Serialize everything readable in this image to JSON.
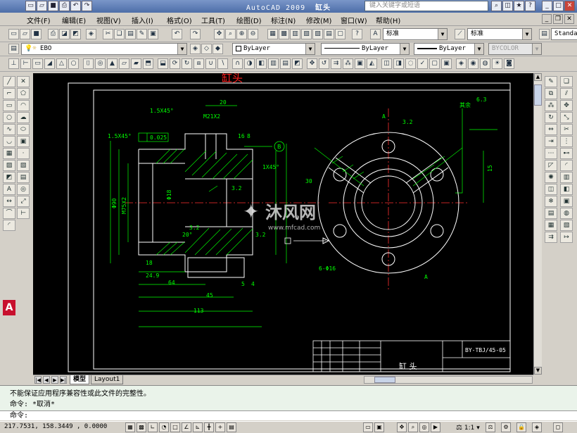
{
  "app": {
    "title": "AutoCAD 2009",
    "document": "缸头",
    "search_placeholder": "键入关键字或短语"
  },
  "menu": [
    "文件(F)",
    "编辑(E)",
    "视图(V)",
    "插入(I)",
    "格式(O)",
    "工具(T)",
    "绘图(D)",
    "标注(N)",
    "修改(M)",
    "窗口(W)",
    "帮助(H)"
  ],
  "toolbar": {
    "text_style": "标准",
    "dim_style": "标准",
    "table_style": "Standar",
    "layer": "EBO",
    "color": "ByLayer",
    "linetype": "ByLayer",
    "lineweight": "ByLayer",
    "plot_style": "BYCOLOR"
  },
  "drawing": {
    "title_label": "缸头",
    "part_name": "缸 头",
    "drawing_no": "BY-TBJ/45-05",
    "roughness_label": "其余",
    "roughness_value": "6.3",
    "dims": {
      "d20": "20",
      "m21": "M21X2",
      "chamfer1": "1.5X45°",
      "chamfer2": "1.5X45°",
      "tol": "0.025",
      "datum_b": "B",
      "d16": "16",
      "d8": "8",
      "d1x45": "1X45°",
      "r32a": "3.2",
      "r32b": "3.2",
      "r32c": "3.2",
      "r32d": "3.2",
      "d18": "18",
      "d249": "24.9",
      "d64": "64",
      "d45": "45",
      "d5": "5",
      "d4": "4",
      "d113": "113",
      "d30": "30",
      "holes": "6-Φ16",
      "m75": "M75X2",
      "phi90": "Φ90",
      "phi18": "Φ18",
      "deg20": "20°",
      "d15": "15",
      "a_label": "A",
      "a_label2": "A"
    },
    "watermark": "沐风网",
    "watermark_url": "www.mfcad.com"
  },
  "tabs": {
    "model": "模型",
    "layout1": "Layout1"
  },
  "command": {
    "line1": "不能保证应用程序兼容性或此文件的完整性。",
    "line2": "命令: *取消*",
    "prompt": "命令:"
  },
  "status": {
    "coords": "217.7531, 158.3449 , 0.0000",
    "scale": "1:1"
  },
  "colors": {
    "drawing_bg": "#000000",
    "green": "#00ff00",
    "white": "#ffffff",
    "red": "#ff3030",
    "title_label": "#ff2020"
  }
}
